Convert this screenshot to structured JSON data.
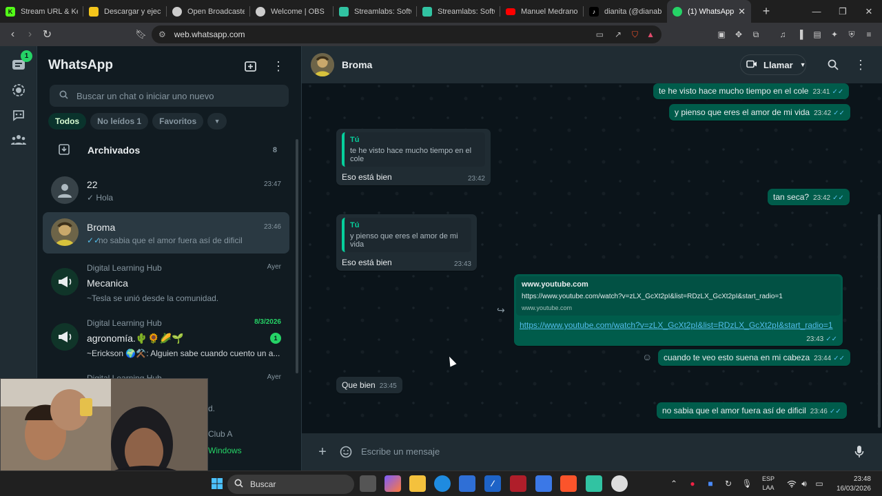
{
  "browser": {
    "tabs": [
      {
        "title": "Stream URL & Key",
        "fav_text": "K",
        "fav_color": "#53fc18"
      },
      {
        "title": "Descargar y ejecut",
        "fav_text": "",
        "fav_color": "#f3c51b"
      },
      {
        "title": "Open Broadcaster",
        "fav_text": "",
        "fav_color": "#cccccc"
      },
      {
        "title": "Welcome | OBS",
        "fav_text": "",
        "fav_color": "#cccccc"
      },
      {
        "title": "Streamlabs: Softw",
        "fav_text": "",
        "fav_color": "#31c3a2"
      },
      {
        "title": "Streamlabs: Softw",
        "fav_text": "",
        "fav_color": "#31c3a2"
      },
      {
        "title": "Manuel Medrano",
        "fav_text": "",
        "fav_color": "#ff0000"
      },
      {
        "title": "dianita (@dianabe",
        "fav_text": "",
        "fav_color": "#000000"
      },
      {
        "title": "(1) WhatsApp",
        "fav_text": "",
        "fav_color": "#25d366"
      }
    ],
    "new_tab_symbol": "+",
    "url": "web.whatsapp.com",
    "window_controls": [
      "—",
      "❐",
      "✕"
    ]
  },
  "rail": {
    "chats_badge": "1"
  },
  "sidebar": {
    "title": "WhatsApp",
    "search_placeholder": "Buscar un chat o iniciar uno nuevo",
    "filters": [
      "Todos",
      "No leídos 1",
      "Favoritos"
    ],
    "archived_label": "Archivados",
    "archived_count": "8",
    "chats": [
      {
        "group": "",
        "name": "22",
        "preview": "✓ Hola",
        "time": "23:47",
        "unread": ""
      },
      {
        "group": "",
        "name": "Broma",
        "preview": "no sabia que el amor fuera así  de dificil",
        "time": "23:46",
        "unread": ""
      },
      {
        "group": "Digital Learning Hub",
        "name": "Mecanica",
        "preview": "~Tesla se unió desde la comunidad.",
        "time": "Ayer",
        "unread": ""
      },
      {
        "group": "Digital Learning Hub",
        "name": "agronomía.🌵🌻🌽🌱",
        "preview": "~Erickson 🌍⚒️: Alguien sabe cuando cuento un a...",
        "time": "8/3/2026",
        "unread": "1"
      },
      {
        "group": "Digital Learning Hub",
        "name": "",
        "preview": "d.",
        "time": "Ayer",
        "unread": ""
      }
    ],
    "partial_row_text": "Club A"
  },
  "chat": {
    "contact_name": "Broma",
    "call_label": "Llamar",
    "messages": [
      {
        "dir": "out",
        "text": "te he visto hace mucho tiempo en el cole",
        "time": "23:41"
      },
      {
        "dir": "out",
        "text": "y pienso que eres el amor de mi vida",
        "time": "23:42"
      },
      {
        "dir": "in",
        "quote_author": "Tú",
        "quote_text": "te he visto hace mucho tiempo en el cole",
        "text": "Eso está bien",
        "time": "23:42"
      },
      {
        "dir": "out",
        "text": "tan seca?",
        "time": "23:42"
      },
      {
        "dir": "in",
        "quote_author": "Tú",
        "quote_text": "y pienso que eres el amor de mi vida",
        "text": "Eso está bien",
        "time": "23:43"
      },
      {
        "dir": "out",
        "link_title": "www.youtube.com",
        "link_desc": "https://www.youtube.com/watch?v=zLX_GcXt2pI&list=RDzLX_GcXt2pI&start_radio=1",
        "link_domain": "www.youtube.com",
        "text": "https://www.youtube.com/watch?v=zLX_GcXt2pI&list=RDzLX_GcXt2pI&start_radio=1",
        "time": "23:43"
      },
      {
        "dir": "out",
        "text": "cuando te veo esto suena en mi cabeza",
        "time": "23:44"
      },
      {
        "dir": "in",
        "text": "Que bien",
        "time": "23:45"
      },
      {
        "dir": "out",
        "text": "no sabia que el amor fuera así  de dificil",
        "time": "23:46"
      }
    ],
    "composer_placeholder": "Escribe un mensaje"
  },
  "overlay": {
    "obs_text": "Windows"
  },
  "taskbar": {
    "search_label": "Buscar",
    "lang_line1": "ESP",
    "lang_line2": "LAA",
    "time": "23:48",
    "date": "16/03/2026"
  }
}
